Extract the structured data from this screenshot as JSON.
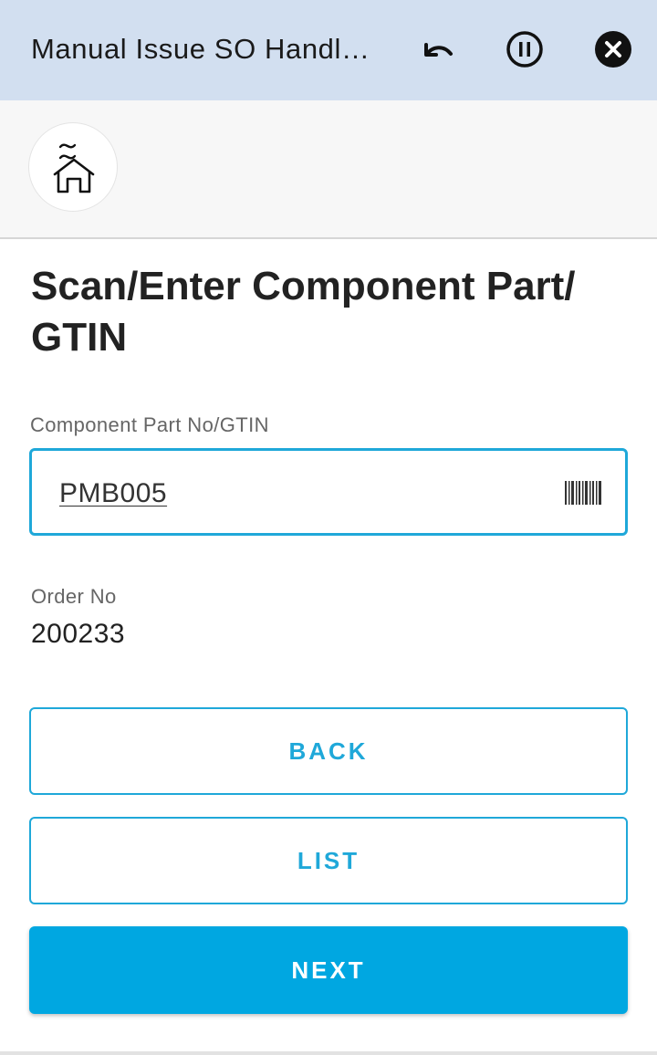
{
  "titlebar": {
    "title": "Manual Issue SO Handl…",
    "icons": [
      "undo-icon",
      "pause-icon",
      "close-icon"
    ]
  },
  "home": {
    "icon": "home-icon"
  },
  "main": {
    "heading": "Scan/Enter Component Part/ GTIN",
    "component_field": {
      "label": "Component Part No/GTIN",
      "value": "PMB005",
      "icon": "barcode-icon"
    },
    "order": {
      "label": "Order No",
      "value": "200233"
    }
  },
  "buttons": {
    "back": "BACK",
    "list": "LIST",
    "next": "NEXT"
  },
  "colors": {
    "titlebar_bg": "#d2dff0",
    "accent": "#1fa8d9",
    "primary_button": "#00a7e1"
  }
}
